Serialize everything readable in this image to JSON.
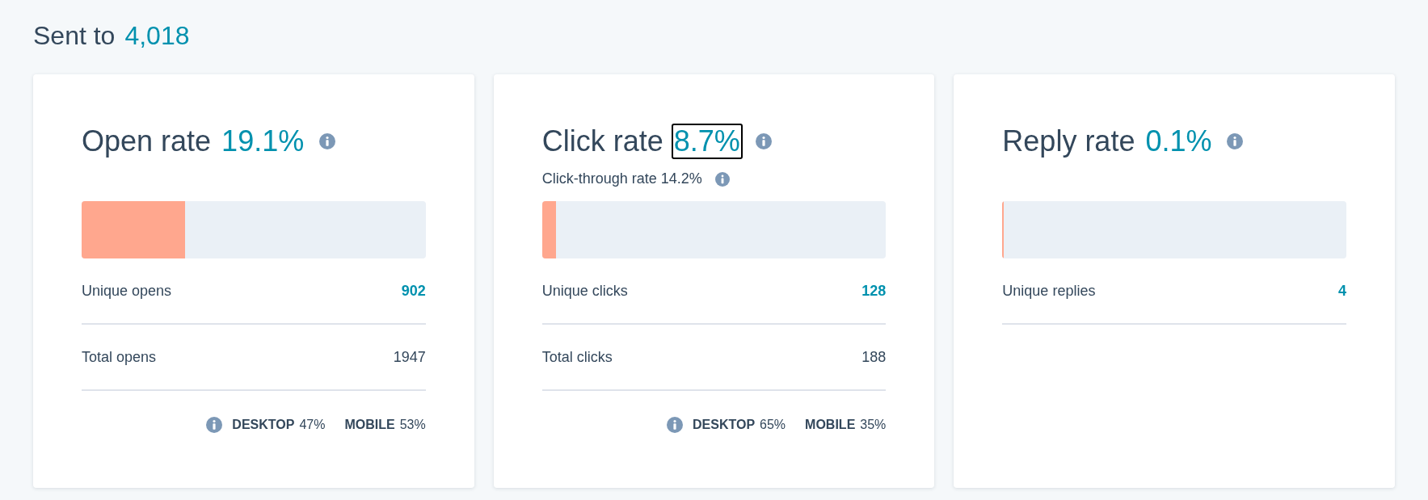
{
  "header": {
    "label": "Sent to",
    "count": "4,018"
  },
  "cards": [
    {
      "title": "Open rate",
      "rate": "19.1%",
      "focused": false,
      "level": 0.3,
      "rows": [
        {
          "label": "Unique opens",
          "value": "902",
          "highlighted": true
        },
        {
          "label": "Total opens",
          "value": "1947",
          "highlighted": false
        }
      ],
      "devices": [
        {
          "label": "DESKTOP",
          "value": "47%"
        },
        {
          "label": "MOBILE",
          "value": "53%"
        }
      ]
    },
    {
      "title": "Click rate",
      "rate": "8.7%",
      "focused": true,
      "subline": "Click-through rate 14.2%",
      "level": 0.04,
      "rows": [
        {
          "label": "Unique clicks",
          "value": "128",
          "highlighted": true
        },
        {
          "label": "Total clicks",
          "value": "188",
          "highlighted": false
        }
      ],
      "devices": [
        {
          "label": "DESKTOP",
          "value": "65%"
        },
        {
          "label": "MOBILE",
          "value": "35%"
        }
      ]
    },
    {
      "title": "Reply rate",
      "rate": "0.1%",
      "focused": false,
      "level": 0.003,
      "rows": [
        {
          "label": "Unique replies",
          "value": "4",
          "highlighted": true
        }
      ]
    }
  ]
}
